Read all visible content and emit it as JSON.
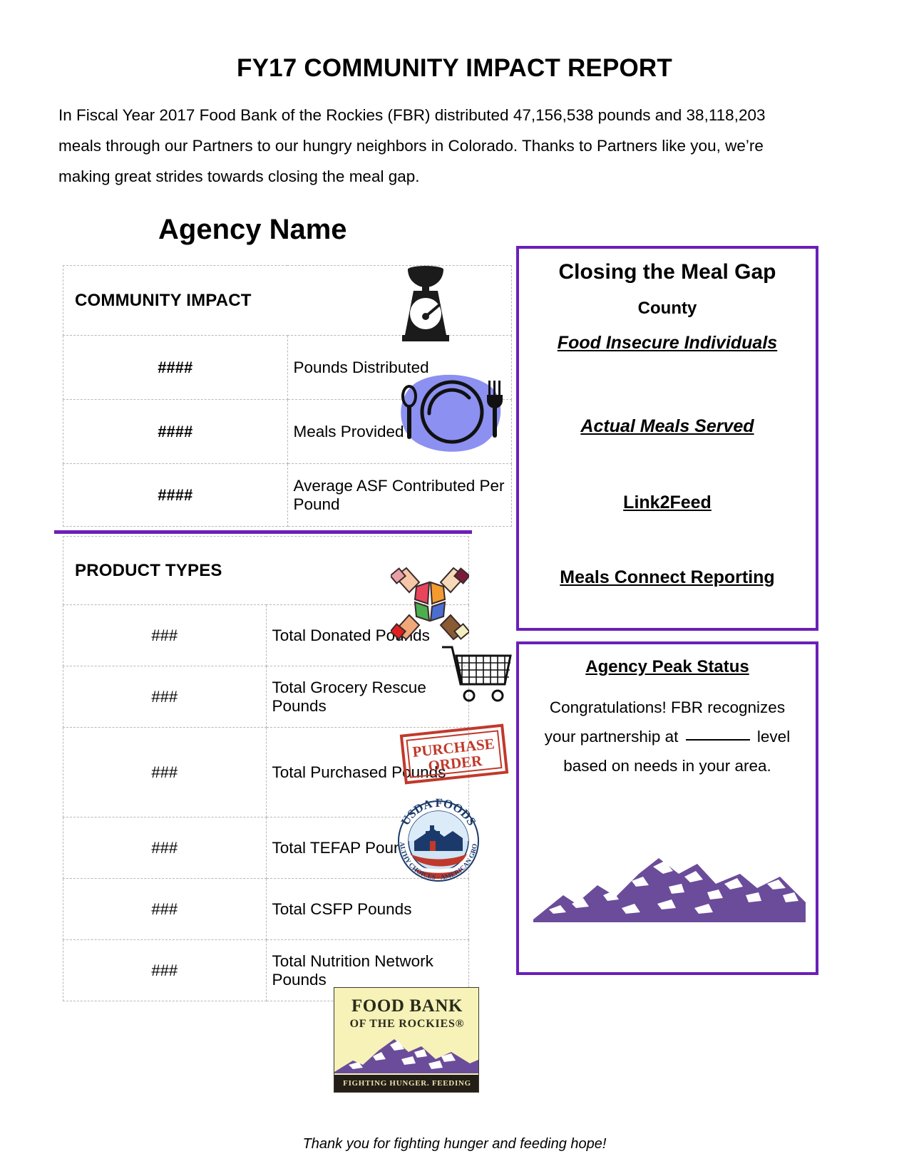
{
  "header": {
    "title": "FY17 COMMUNITY IMPACT REPORT",
    "intro": "In  Fiscal Year 2017 Food Bank of the Rockies (FBR) distributed 47,156,538 pounds and 38,118,203 meals through our Partners to our hungry neighbors in Colorado.  Thanks to Partners like you, we’re making great strides towards closing the meal gap."
  },
  "agency": {
    "name": "Agency Name"
  },
  "community_impact": {
    "heading": "COMMUNITY IMPACT",
    "rows": [
      {
        "value": "####",
        "label": "Pounds Distributed",
        "icon": "kitchen-scale-icon"
      },
      {
        "value": "####",
        "label": "Meals Provided",
        "icon": "plate-cutlery-icon"
      },
      {
        "value": "####",
        "label": "Average ASF Contributed Per Pound",
        "icon": ""
      }
    ]
  },
  "product_types": {
    "heading": "PRODUCT TYPES",
    "rows": [
      {
        "value": "###",
        "label": "Total Donated Pounds",
        "icon": "hands-puzzle-icon"
      },
      {
        "value": "###",
        "label": "Total Grocery Rescue Pounds",
        "icon": "shopping-cart-icon"
      },
      {
        "value": "###",
        "label": "Total Purchased Pounds",
        "icon": "purchase-order-stamp-icon"
      },
      {
        "value": "###",
        "label": "Total TEFAP Pounds",
        "icon": "usda-foods-icon"
      },
      {
        "value": "###",
        "label": "Total CSFP Pounds",
        "icon": ""
      },
      {
        "value": "###",
        "label": "Total Nutrition Network Pounds",
        "icon": ""
      }
    ]
  },
  "meal_gap": {
    "title": "Closing the Meal Gap",
    "subtitle": "County",
    "items": [
      "Food Insecure Individuals",
      "Actual Meals Served",
      "Link2Feed",
      "Meals Connect Reporting"
    ]
  },
  "peak_status": {
    "title": "Agency Peak Status",
    "line1": "Congratulations! FBR recognizes",
    "line2_before": "your partnership at",
    "line2_after": "level",
    "line3": "based on needs in your area.",
    "graphic": "mountain-range-icon"
  },
  "footer": {
    "logo_line1": "FOOD BANK",
    "logo_line2": "OF THE ROCKIES®",
    "logo_tagline": "FIGHTING HUNGER.  FEEDING HOPE.",
    "thank_you": "Thank you for fighting hunger and feeding hope!"
  },
  "icons": {
    "purchase_order_line1": "PURCHASE",
    "purchase_order_line2": "ORDER",
    "usda_top": "USDA FOODS",
    "usda_bottom": "HEALTHY CHOICES · AMERICAN GROWN"
  },
  "colors": {
    "brand_purple": "#6B1FB8",
    "mountain_purple": "#6B4C9A",
    "plate_blue": "#8C90F0",
    "logo_cream": "#F6F2B8",
    "stamp_red": "#C0392B"
  }
}
